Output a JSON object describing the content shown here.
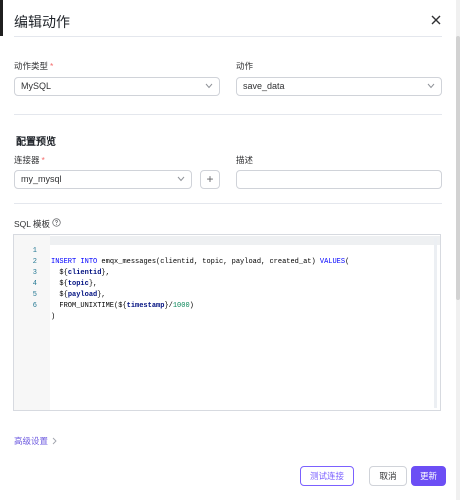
{
  "dialog": {
    "title": "编辑动作"
  },
  "form": {
    "action_type": {
      "label": "动作类型",
      "required_mark": "*",
      "value": "MySQL"
    },
    "action": {
      "label": "动作",
      "value": "save_data"
    },
    "config_preview": {
      "title": "配置预览"
    },
    "connector": {
      "label": "连接器",
      "required_mark": "*",
      "value": "my_mysql",
      "add_label": "+"
    },
    "description": {
      "label": "描述",
      "value": ""
    },
    "sql_template": {
      "label": "SQL 模板"
    }
  },
  "editor": {
    "lines": [
      {
        "n": "1",
        "text": "INSERT INTO emqx_messages(clientid, topic, payload, created_at) VALUES("
      },
      {
        "n": "2",
        "text": "  ${clientid},"
      },
      {
        "n": "3",
        "text": "  ${topic},"
      },
      {
        "n": "4",
        "text": "  ${payload},"
      },
      {
        "n": "5",
        "text": "  FROM_UNIXTIME(${timestamp}/1000)"
      },
      {
        "n": "6",
        "text": ")"
      }
    ]
  },
  "advanced": {
    "label": "高级设置"
  },
  "footer": {
    "test_label": "测试连接",
    "cancel_label": "取消",
    "update_label": "更新"
  },
  "colors": {
    "accent": "#6c4ef5",
    "required": "#f56c6c",
    "line_number": "#237893",
    "keyword": "#0000ff"
  },
  "icons": [
    "close-icon",
    "chevron-down-icon",
    "plus-icon",
    "help-circle-icon",
    "chevron-right-icon"
  ]
}
